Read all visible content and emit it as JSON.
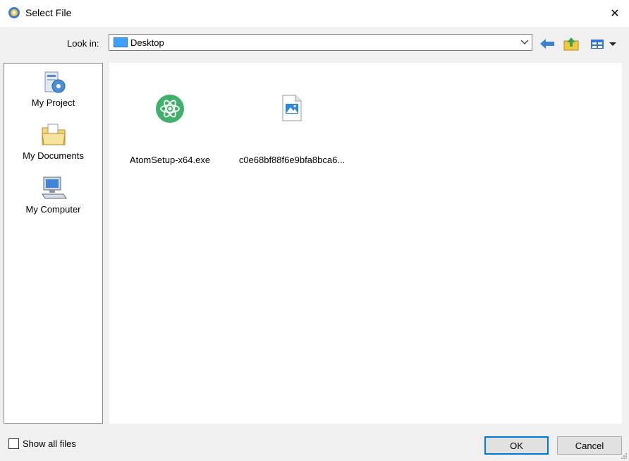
{
  "window": {
    "title": "Select File",
    "close_glyph": "✕"
  },
  "toolbar": {
    "look_in_label": "Look in:",
    "look_in_value": "Desktop",
    "icons": [
      "back-arrow-icon",
      "up-folder-icon",
      "view-menu-icon"
    ]
  },
  "places": [
    {
      "label": "My Project",
      "icon": "project-icon"
    },
    {
      "label": "My Documents",
      "icon": "documents-folder-icon"
    },
    {
      "label": "My Computer",
      "icon": "computer-icon"
    }
  ],
  "files": [
    {
      "label": "AtomSetup-x64.exe",
      "icon": "atom-icon"
    },
    {
      "label": "c0e68bf88f6e9bfa8bca6...",
      "icon": "image-file-icon"
    }
  ],
  "footer": {
    "show_all_label": "Show all files",
    "show_all_checked": false,
    "ok_label": "OK",
    "cancel_label": "Cancel"
  },
  "colors": {
    "accent": "#0078d7",
    "atom_green": "#40b06a"
  }
}
